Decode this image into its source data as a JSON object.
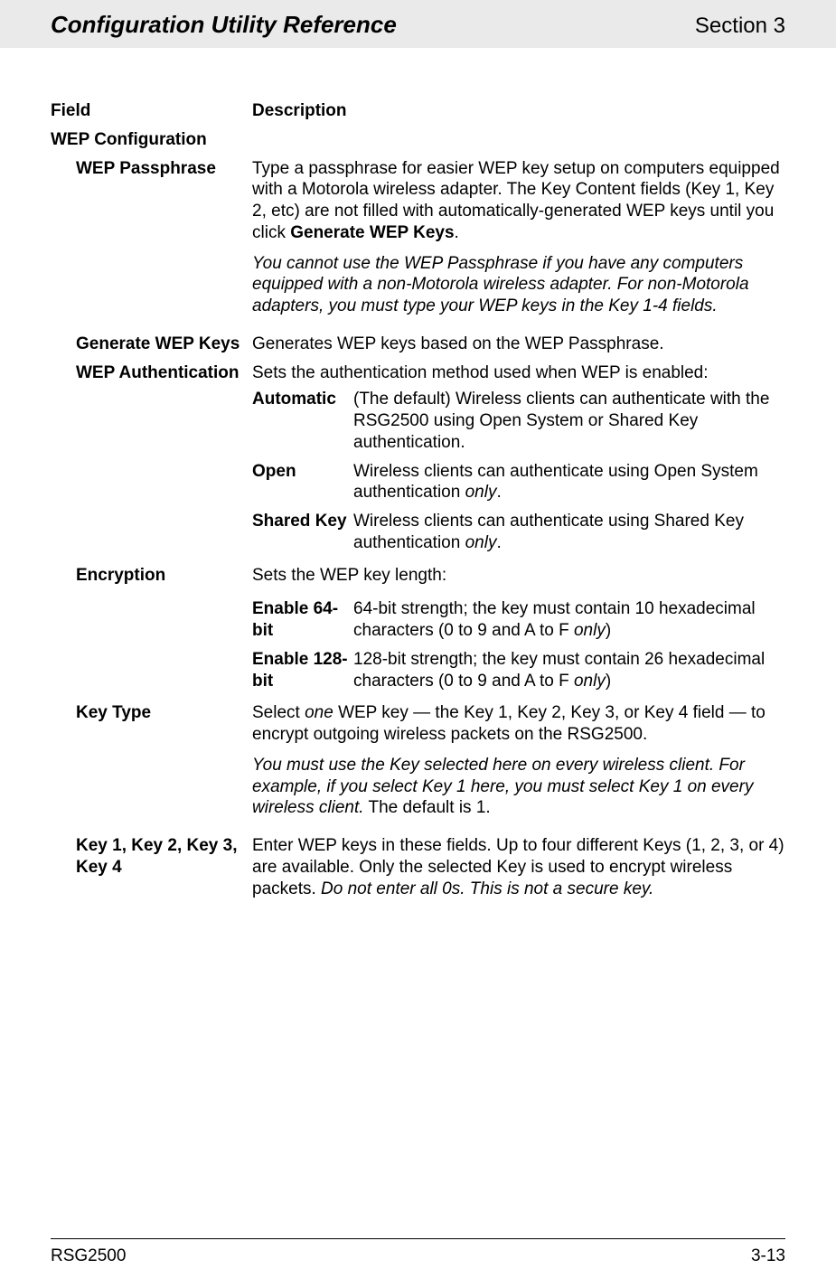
{
  "header": {
    "title_left": "Configuration Utility Reference",
    "title_right": "Section 3"
  },
  "table_header": {
    "field": "Field",
    "description": "Description"
  },
  "section_title": "WEP Configuration",
  "rows": {
    "wep_passphrase": {
      "field": "WEP Passphrase",
      "p1_a": "Type a passphrase for easier WEP key setup on computers equipped with a Motorola wireless adapter. The Key Content fields (Key 1, Key 2, etc) are not filled with automatically-generated WEP keys until you click ",
      "p1_bold": "Generate WEP Keys",
      "p1_b": ".",
      "p2_italic": "You cannot use the WEP Passphrase if you have any computers equipped with a non-Motorola wireless adapter. For non-Motorola adapters, you must type your WEP keys in the Key 1-4 fields."
    },
    "generate_wep_keys": {
      "field": "Generate WEP Keys",
      "desc": "Generates WEP keys based on the WEP Passphrase."
    },
    "wep_auth": {
      "field": "WEP Authentication",
      "intro": "Sets the authentication method used when WEP is enabled:",
      "opts": {
        "automatic": {
          "key": "Automatic",
          "desc": "(The default) Wireless clients can authenticate with the RSG2500 using Open System or Shared Key authentication."
        },
        "open": {
          "key": "Open",
          "desc_a": "Wireless clients can authenticate using Open System authentication ",
          "desc_em": "only",
          "desc_b": "."
        },
        "shared": {
          "key": "Shared Key",
          "desc_a": "Wireless clients can authenticate using Shared Key authentication ",
          "desc_em": "only",
          "desc_b": "."
        }
      }
    },
    "encryption": {
      "field": "Encryption",
      "intro": "Sets the WEP key length:",
      "opts": {
        "e64": {
          "key": "Enable 64-bit",
          "desc_a": "64-bit strength; the key must contain 10 hexadecimal characters (0 to 9 and A to F ",
          "desc_em": "only",
          "desc_b": ")"
        },
        "e128": {
          "key": "Enable 128-bit",
          "desc_a": "128-bit strength; the key must contain 26 hexadecimal characters (0 to 9 and A to F ",
          "desc_em": "only",
          "desc_b": ")"
        }
      }
    },
    "key_type": {
      "field": "Key Type",
      "p1_a": "Select ",
      "p1_em": "one",
      "p1_b": " WEP key — the Key 1, Key 2, Key 3, or Key 4 field — to encrypt outgoing wireless packets on the RSG2500.",
      "p2_em": "You must use the Key selected here on every wireless client. For example, if you select Key 1 here, you must select Key 1 on every wireless client.",
      "p2_b": " The default is 1."
    },
    "key1234": {
      "field": "Key 1, Key 2, Key 3, Key 4",
      "desc_a": "Enter WEP keys in these fields. Up to four different Keys (1, 2, 3, or 4) are available. Only the selected Key is used to encrypt wireless packets. ",
      "desc_em": "Do not enter all 0s. This is not a secure key."
    }
  },
  "footer": {
    "left": "RSG2500",
    "right": "3-13"
  }
}
